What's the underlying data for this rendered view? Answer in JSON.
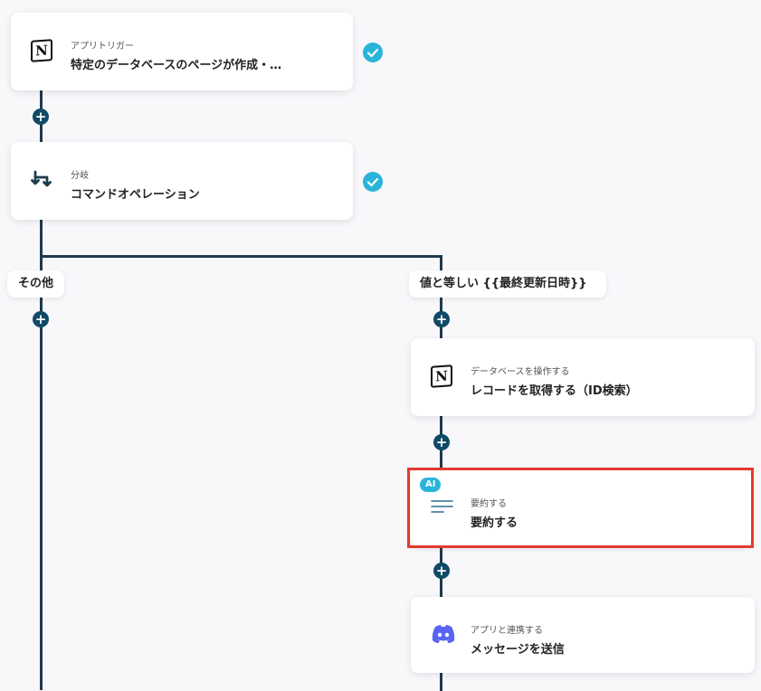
{
  "colors": {
    "connector": "#1f3a4d",
    "plus": "#0f4a67",
    "check": "#2ab4d9",
    "highlight": "#e53a2f",
    "discord": "#5865f2",
    "ai_badge": "#2ab4d9"
  },
  "steps": [
    {
      "sub": "アプリトリガー",
      "title": "特定のデータベースのページが作成・…",
      "icon": "notion-icon",
      "done": true
    },
    {
      "sub": "分岐",
      "title": "コマンドオペレーション",
      "icon": "branch-icon",
      "done": true
    },
    {
      "sub": "データベースを操作する",
      "title": "レコードを取得する（ID検索）",
      "icon": "notion-icon"
    },
    {
      "sub": "要約する",
      "title": "要約する",
      "icon": "summary-lines-icon",
      "badge": "AI",
      "highlighted": true
    },
    {
      "sub": "アプリと連携する",
      "title": "メッセージを送信",
      "icon": "discord-icon"
    }
  ],
  "branches": {
    "left_label": "その他",
    "right_label": "値と等しい {{最終更新日時}}"
  },
  "add_button_label": "+",
  "notion_glyph": "N"
}
